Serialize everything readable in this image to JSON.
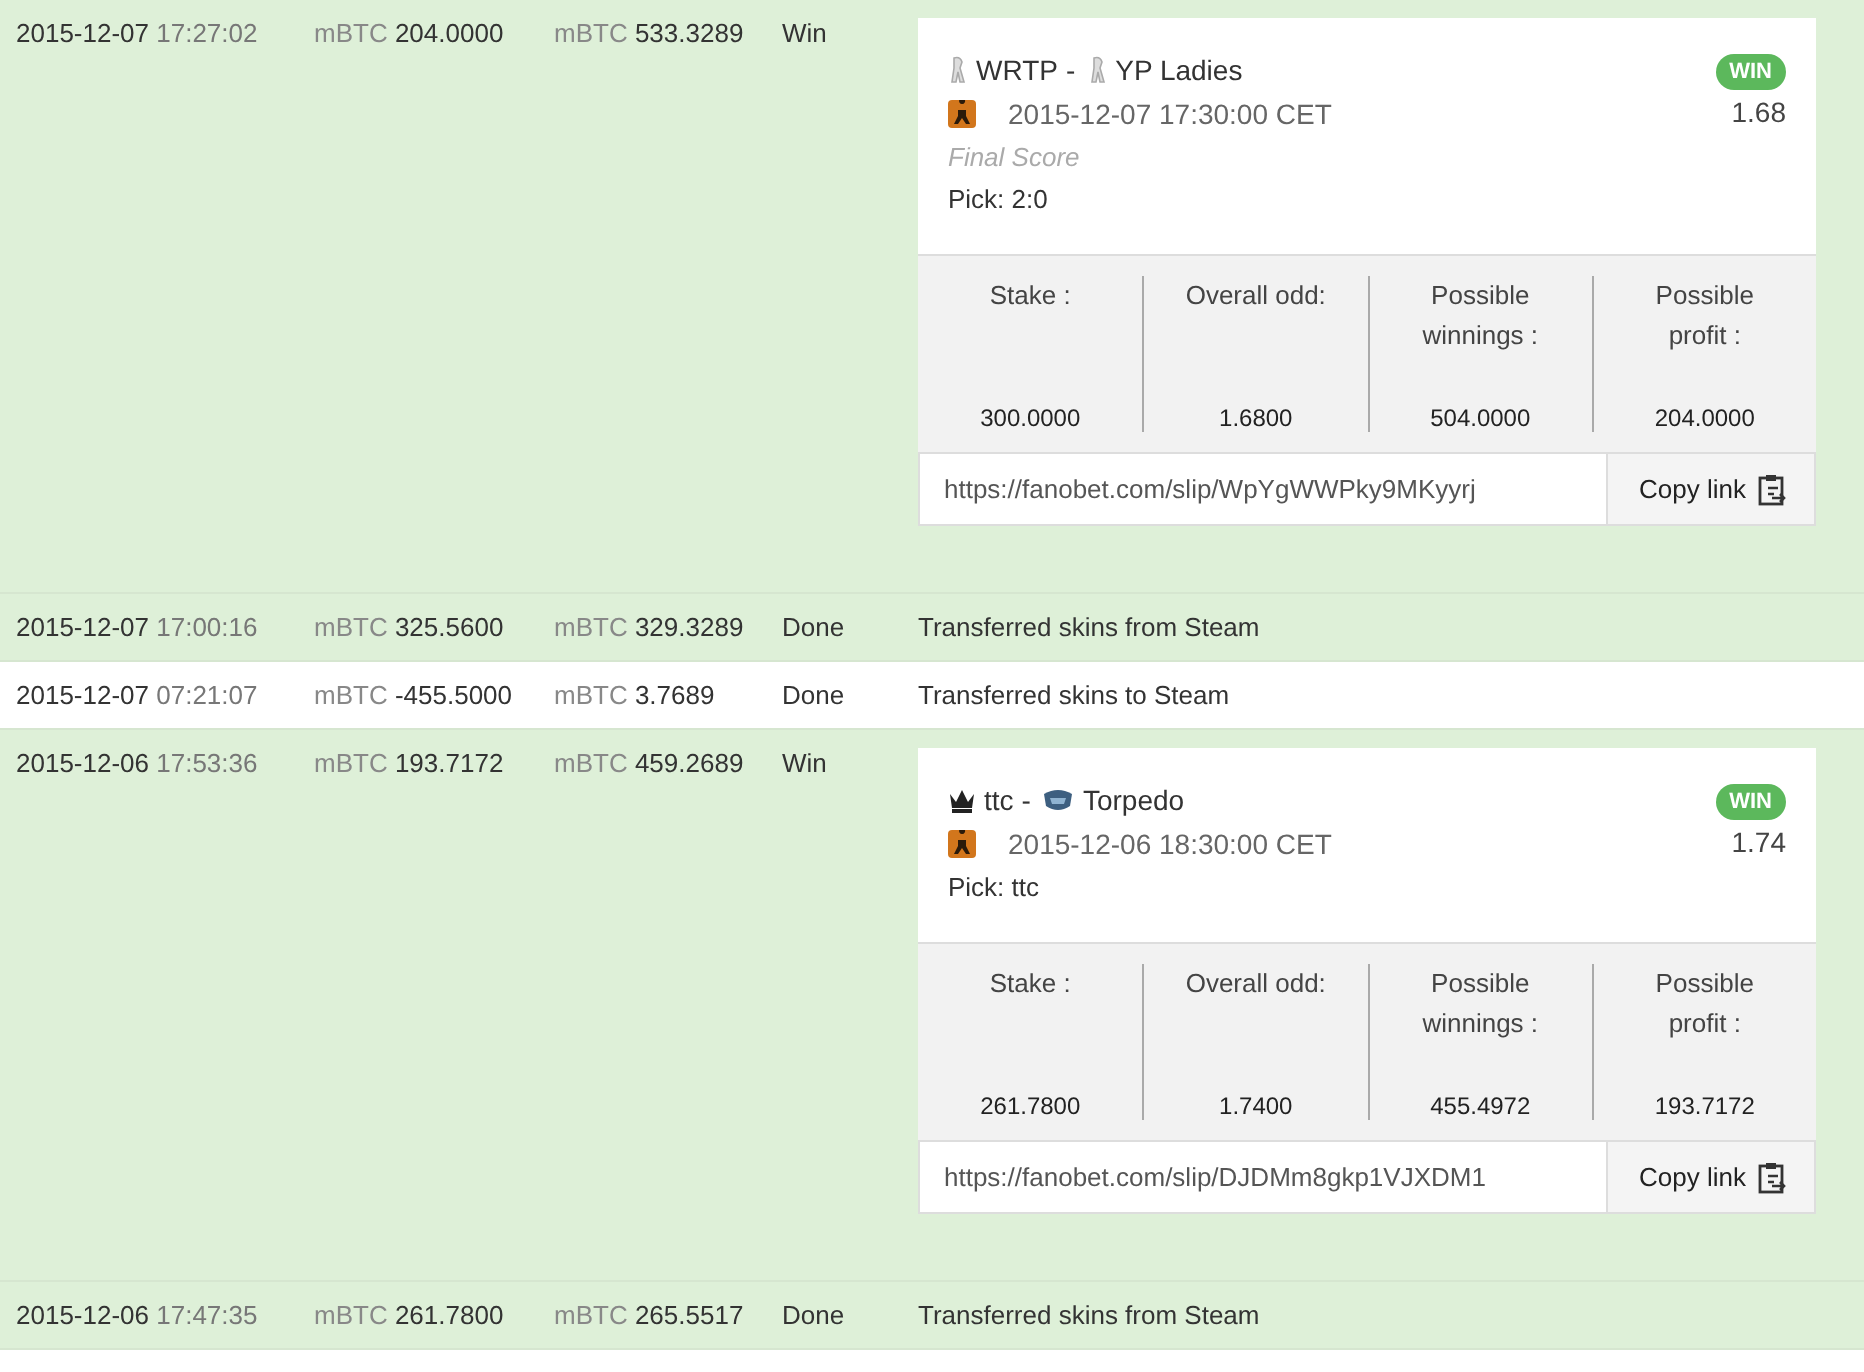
{
  "transactions": [
    {
      "highlighted": true,
      "date": "2015-12-07",
      "time": "17:27:02",
      "amount": {
        "unit": "mBTC",
        "value": "204.0000"
      },
      "balance": {
        "unit": "mBTC",
        "value": "533.3289"
      },
      "status": "Win",
      "bet": {
        "teams": [
          {
            "name": "WRTP",
            "kind": "figure"
          },
          {
            "name": "YP Ladies",
            "kind": "figure"
          }
        ],
        "separator": "-",
        "start": "2015-12-07 17:30:00 CET",
        "note": "Final Score",
        "pick": "Pick: 2:0",
        "result": "WIN",
        "odds": "1.68",
        "stats": [
          {
            "label": "Stake :",
            "value": "300.0000"
          },
          {
            "label": "Overall odd:",
            "value": "1.6800"
          },
          {
            "label": "Possible winnings :",
            "value": "504.0000"
          },
          {
            "label": "Possible profit :",
            "value": "204.0000"
          }
        ],
        "link": "https://fanobet.com/slip/WpYgWWPky9MKyyrj",
        "copy": "Copy link"
      }
    },
    {
      "highlighted": true,
      "date": "2015-12-07",
      "time": "17:00:16",
      "amount": {
        "unit": "mBTC",
        "value": "325.5600"
      },
      "balance": {
        "unit": "mBTC",
        "value": "329.3289"
      },
      "status": "Done",
      "description": "Transferred skins from Steam"
    },
    {
      "highlighted": false,
      "date": "2015-12-07",
      "time": "07:21:07",
      "amount": {
        "unit": "mBTC",
        "value": "-455.5000"
      },
      "balance": {
        "unit": "mBTC",
        "value": "3.7689"
      },
      "status": "Done",
      "description": "Transferred skins to Steam"
    },
    {
      "highlighted": true,
      "date": "2015-12-06",
      "time": "17:53:36",
      "amount": {
        "unit": "mBTC",
        "value": "193.7172"
      },
      "balance": {
        "unit": "mBTC",
        "value": "459.2689"
      },
      "status": "Win",
      "bet": {
        "teams": [
          {
            "name": "ttc",
            "kind": "crown"
          },
          {
            "name": "Torpedo",
            "kind": "shield"
          }
        ],
        "separator": "-",
        "start": "2015-12-06 18:30:00 CET",
        "pick": "Pick: ttc",
        "result": "WIN",
        "odds": "1.74",
        "stats": [
          {
            "label": "Stake :",
            "value": "261.7800"
          },
          {
            "label": "Overall odd:",
            "value": "1.7400"
          },
          {
            "label": "Possible winnings :",
            "value": "455.4972"
          },
          {
            "label": "Possible profit :",
            "value": "193.7172"
          }
        ],
        "link": "https://fanobet.com/slip/DJDMm8gkp1VJXDM1",
        "copy": "Copy link"
      }
    },
    {
      "highlighted": true,
      "date": "2015-12-06",
      "time": "17:47:35",
      "amount": {
        "unit": "mBTC",
        "value": "261.7800"
      },
      "balance": {
        "unit": "mBTC",
        "value": "265.5517"
      },
      "status": "Done",
      "description": "Transferred skins from Steam"
    }
  ]
}
